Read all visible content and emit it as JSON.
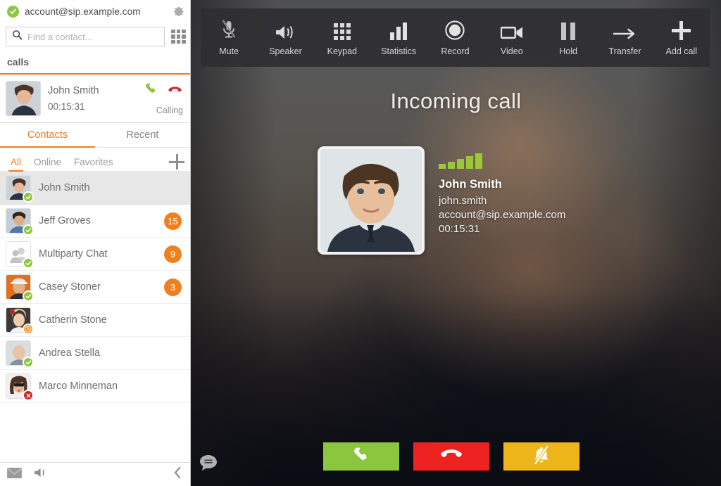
{
  "sidebar": {
    "account": {
      "name": "account@sip.example.com",
      "presence": "online",
      "presence_icon": "check-circle-icon",
      "settings_icon": "gear-icon"
    },
    "search": {
      "placeholder": "Find a contact...",
      "value": "",
      "icon": "search-icon",
      "dialpad_icon": "grid-dialpad-icon"
    },
    "section_label": "calls",
    "active_call": {
      "name": "John Smith",
      "timer": "00:15:31",
      "status": "Calling",
      "answer_icon": "phone-icon",
      "hangup_icon": "phone-hangup-icon"
    },
    "tabs": [
      {
        "label": "Contacts",
        "active": true
      },
      {
        "label": "Recent",
        "active": false
      }
    ],
    "filters": [
      {
        "label": "All",
        "active": true
      },
      {
        "label": "Online",
        "active": false
      },
      {
        "label": "Favorites",
        "active": false
      }
    ],
    "add_contact_icon": "plus-icon",
    "contacts": [
      {
        "name": "John Smith",
        "status": "online",
        "badge": "",
        "selected": true,
        "avatar": "man-dark-shirt"
      },
      {
        "name": "Jeff Groves",
        "status": "online",
        "badge": "15",
        "selected": false,
        "avatar": "man-blue-shirt"
      },
      {
        "name": "Multiparty Chat",
        "status": "online",
        "badge": "9",
        "selected": false,
        "avatar": "group-placeholder"
      },
      {
        "name": "Casey Stoner",
        "status": "online",
        "badge": "3",
        "selected": false,
        "avatar": "man-orange-cap"
      },
      {
        "name": "Catherin Stone",
        "status": "away",
        "badge": "",
        "selected": false,
        "avatar": "woman-flower"
      },
      {
        "name": "Andrea Stella",
        "status": "online",
        "badge": "",
        "selected": false,
        "avatar": "older-man"
      },
      {
        "name": "Marco Minneman",
        "status": "offline",
        "badge": "",
        "selected": false,
        "avatar": "woman-sunglasses"
      }
    ],
    "footer": {
      "voicemail_icon": "envelope-icon",
      "speaker_icon": "speaker-icon",
      "collapse_icon": "chevron-left-icon"
    }
  },
  "call": {
    "headline": "Incoming call",
    "toolbar": [
      {
        "label": "Mute",
        "icon": "microphone-muted-icon"
      },
      {
        "label": "Speaker",
        "icon": "speaker-icon"
      },
      {
        "label": "Keypad",
        "icon": "grid-dialpad-icon"
      },
      {
        "label": "Statistics",
        "icon": "bar-chart-icon"
      },
      {
        "label": "Record",
        "icon": "record-circle-icon"
      },
      {
        "label": "Video",
        "icon": "video-camera-icon"
      },
      {
        "label": "Hold",
        "icon": "pause-icon"
      },
      {
        "label": "Transfer",
        "icon": "arrow-right-icon"
      },
      {
        "label": "Add call",
        "icon": "plus-icon"
      }
    ],
    "caller": {
      "name": "John Smith",
      "username": "john.smith",
      "account": "account@sip.example.com",
      "timer": "00:15:31",
      "signal_bars": 5,
      "signal_max": 5,
      "avatar": "man-dark-shirt"
    },
    "actions": [
      {
        "name": "accept",
        "icon": "phone-icon",
        "color": "#8cc63e"
      },
      {
        "name": "decline",
        "icon": "phone-hangup-icon",
        "color": "#ef2222"
      },
      {
        "name": "silence",
        "icon": "bell-muted-icon",
        "color": "#eeb51a"
      }
    ],
    "chat_icon": "chat-bubble-icon"
  },
  "colors": {
    "accent": "#f07c22",
    "online": "#8cc63e",
    "away": "#f0891f",
    "offline": "#cf2323",
    "badge": "#f0801e",
    "accept": "#8cc63e",
    "decline": "#ef2222",
    "silence": "#eeb51a",
    "signal": "#9ac83a"
  }
}
